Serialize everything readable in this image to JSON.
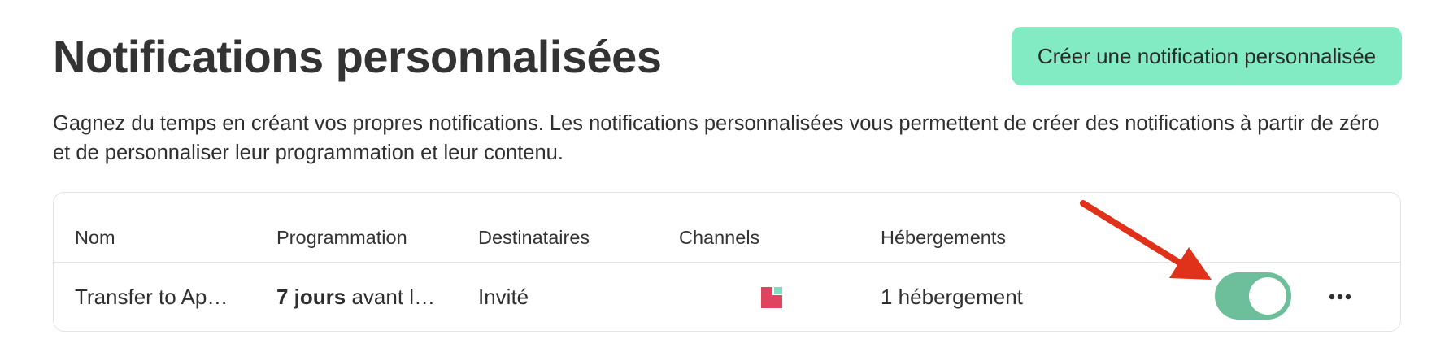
{
  "header": {
    "title": "Notifications personnalisées",
    "create_button_label": "Créer une notification personnalisée"
  },
  "description": "Gagnez du temps en créant vos propres notifications. Les notifications personnalisées vous permettent de créer des notifications à partir de zéro et de personnaliser leur programmation et leur contenu.",
  "table": {
    "columns": [
      "Nom",
      "Programmation",
      "Destinataires",
      "Channels",
      "Hébergements"
    ],
    "rows": [
      {
        "name": "Transfer to Apar…",
        "schedule_bold": "7 jours",
        "schedule_rest": " avant l'a…",
        "recipients": "Invité",
        "channel_icon": "square-channel-icon",
        "listings": "1 hébergement",
        "enabled": true,
        "more_icon": "more-horizontal-icon"
      }
    ]
  },
  "colors": {
    "accent_button": "#83ebc4",
    "toggle_on": "#6cbf9a",
    "channel_icon_primary": "#e0435f",
    "channel_icon_secondary": "#7fe0c0",
    "annotation_arrow": "#e0321b"
  }
}
